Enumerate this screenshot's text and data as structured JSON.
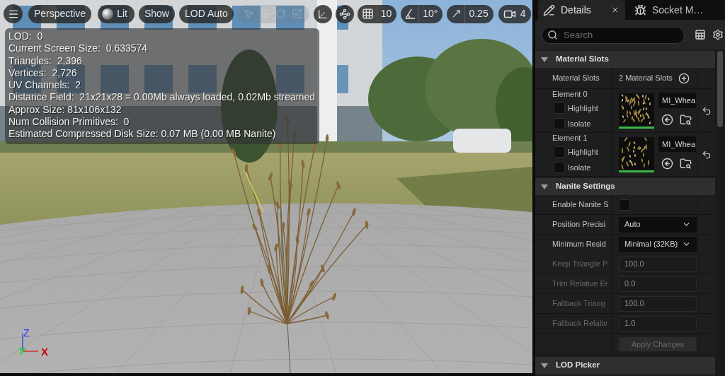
{
  "viewport": {
    "toolbar": {
      "view_buttons": [
        {
          "kind": "plain",
          "label": "Perspective"
        },
        {
          "kind": "lit",
          "label": "Lit"
        },
        {
          "kind": "plain",
          "label": "Show"
        },
        {
          "kind": "plain",
          "label": "LOD Auto"
        }
      ],
      "transform_tools": {
        "disabled": true
      },
      "snaps": [
        {
          "kind": "grid",
          "value": "10"
        },
        {
          "kind": "angle",
          "value": "10°"
        },
        {
          "kind": "scale",
          "value": "0.25"
        },
        {
          "kind": "camera_speed",
          "value": "4"
        }
      ]
    },
    "stats": [
      "LOD:  0",
      "Current Screen Size:  0.633574",
      "Triangles:  2,396",
      "Vertices:  2,726",
      "UV Channels:  2",
      "Distance Field:  21x21x28 = 0.00Mb always loaded, 0.02Mb streamed",
      "Approx Size: 81x106x132",
      "Num Collision Primitives:  0",
      "Estimated Compressed Disk Size: 0.07 MB (0.00 MB Nanite)"
    ],
    "axes": [
      {
        "kind": "z",
        "label": "Z"
      },
      {
        "kind": "x",
        "label": "X"
      }
    ]
  },
  "details": {
    "tabs": [
      {
        "kind": "details",
        "label": "Details",
        "selected": true
      },
      {
        "kind": "socket_manager",
        "label": "Socket M…",
        "selected": false
      }
    ],
    "search": {
      "placeholder": "Search"
    },
    "sections": [
      {
        "kind": "material_slots",
        "title": "Material Slots",
        "expanded": true,
        "summary": {
          "label": "Material Slots",
          "value": "2 Material Slots"
        },
        "elements": [
          {
            "label": "Element 0",
            "options": [
              {
                "label": "Highlight",
                "checked": false
              },
              {
                "label": "Isolate",
                "checked": false
              }
            ],
            "material": "MI_Whea"
          },
          {
            "label": "Element 1",
            "options": [
              {
                "label": "Highlight",
                "checked": false
              },
              {
                "label": "Isolate",
                "checked": false
              }
            ],
            "material": "MI_Whea"
          }
        ]
      },
      {
        "kind": "properties",
        "title": "Nanite Settings",
        "expanded": true,
        "rows": [
          {
            "kind": "checkbox",
            "label": "Enable Nanite S",
            "checked": false,
            "disabled": false
          },
          {
            "kind": "dropdown",
            "label": "Position Precisi",
            "value": "Auto",
            "disabled": false
          },
          {
            "kind": "dropdown",
            "label": "Minimum Resid",
            "value": "Minimal (32KB)",
            "disabled": false
          },
          {
            "kind": "number",
            "label": "Keep Triangle P",
            "value": "100.0",
            "disabled": true
          },
          {
            "kind": "number",
            "label": "Trim Relative Er",
            "value": "0.0",
            "disabled": true
          },
          {
            "kind": "number",
            "label": "Fallback Triang",
            "value": "100.0",
            "disabled": true
          },
          {
            "kind": "number",
            "label": "Fallback Relativ",
            "value": "1.0",
            "disabled": true
          },
          {
            "kind": "button",
            "label": "Apply Changes",
            "disabled": true
          }
        ]
      },
      {
        "kind": "properties",
        "title": "LOD Picker",
        "expanded": true
      }
    ]
  }
}
